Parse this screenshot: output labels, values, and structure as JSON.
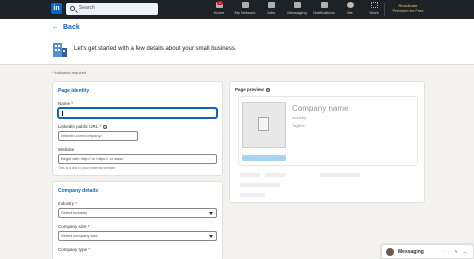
{
  "nav": {
    "logo_text": "in",
    "search_placeholder": "Search",
    "items": [
      {
        "label": "Home",
        "icon": "home-icon"
      },
      {
        "label": "My Network",
        "icon": "network-icon"
      },
      {
        "label": "Jobs",
        "icon": "briefcase-icon"
      },
      {
        "label": "Messaging",
        "icon": "chat-icon"
      },
      {
        "label": "Notifications",
        "icon": "bell-icon"
      },
      {
        "label": "Me",
        "icon": "avatar-icon"
      },
      {
        "label": "Work",
        "icon": "grid-icon"
      }
    ],
    "home_badge": "1",
    "premium_line1": "Reactivate",
    "premium_line2": "Premium for Free"
  },
  "header": {
    "back_label": "Back",
    "title": "Let's get started with a few details about your small business."
  },
  "required_note": "* indicates required",
  "page_identity": {
    "title": "Page identity",
    "name_label": "Name",
    "name_value": "",
    "url_label": "LinkedIn public URL",
    "url_prefix": "linkedin.com/company/",
    "website_label": "Website",
    "website_placeholder": "Begin with http:// or https:// or www.",
    "website_hint": "This is a link to your external website."
  },
  "company_details": {
    "title": "Company details",
    "industry_label": "Industry",
    "industry_value": "Select industry",
    "size_label": "Company size",
    "size_value": "Select company size",
    "type_label": "Company type"
  },
  "preview": {
    "title": "Page preview",
    "company_name": "Company name",
    "industry": "Industry",
    "tagline": "Tagline"
  },
  "messaging": {
    "label": "Messaging",
    "icons": "··· ✎ ︿"
  },
  "colors": {
    "accent": "#0a66c2",
    "nav_bg": "#1d2226",
    "page_bg": "#f3f2ef"
  }
}
